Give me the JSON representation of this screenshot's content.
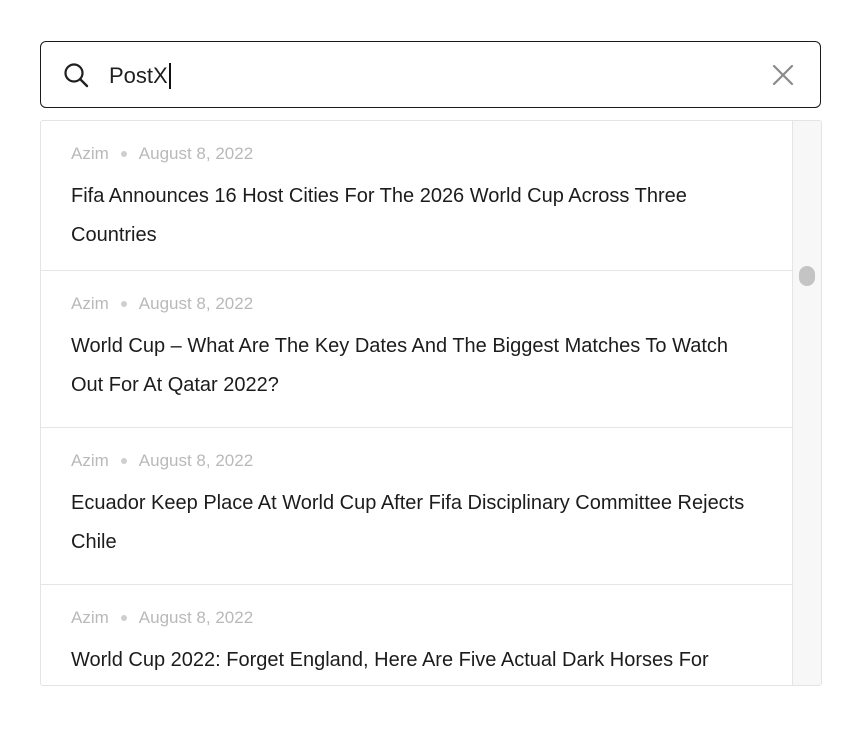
{
  "search": {
    "value": "PostX",
    "icon": "search-icon",
    "clear_icon": "close-icon"
  },
  "results": [
    {
      "author": "Azim",
      "date": "August 8, 2022",
      "title": "Fifa Announces 16 Host Cities For The 2026 World Cup Across Three Countries"
    },
    {
      "author": "Azim",
      "date": "August 8, 2022",
      "title": "World Cup – What Are The Key Dates And The Biggest Matches To Watch Out For At Qatar 2022?"
    },
    {
      "author": "Azim",
      "date": "August 8, 2022",
      "title": "Ecuador Keep Place At World Cup After Fifa Disciplinary Committee Rejects Chile"
    },
    {
      "author": "Azim",
      "date": "August 8, 2022",
      "title": "World Cup 2022: Forget England, Here Are Five Actual Dark Horses For"
    }
  ],
  "colors": {
    "border": "#1a1a1a",
    "meta_text": "#b9b9b9",
    "title_text": "#1c1c1c",
    "scroll_thumb": "#c4c4c4"
  }
}
